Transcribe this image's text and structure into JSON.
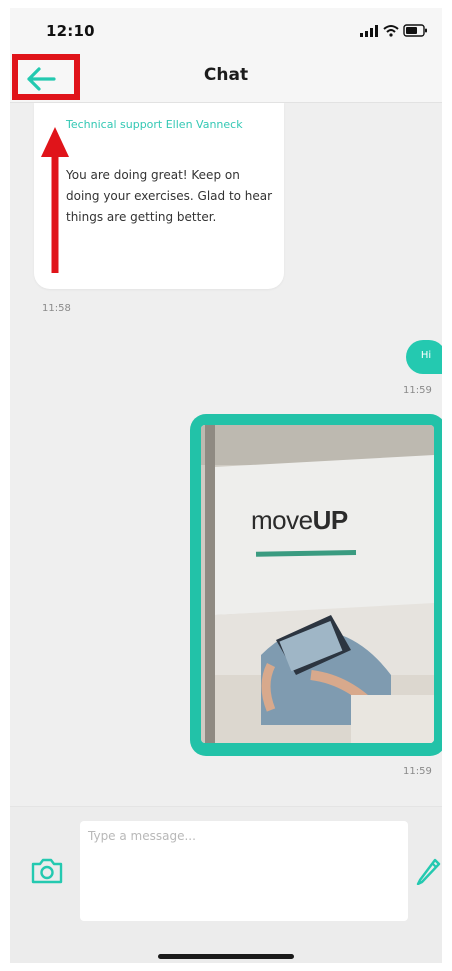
{
  "status_bar": {
    "time": "12:10"
  },
  "header": {
    "title": "Chat",
    "back_icon": "arrow-left-icon"
  },
  "messages": [
    {
      "direction": "incoming",
      "sender": "Technical support Ellen Vanneck",
      "text": "You are doing great! Keep on doing your exercises. Glad to hear things are getting better.",
      "time": "11:58"
    },
    {
      "direction": "outgoing",
      "text": "Hi",
      "time": "11:59"
    },
    {
      "direction": "outgoing",
      "type": "photo",
      "photo_text": "moveUP",
      "time": "11:59"
    }
  ],
  "composer": {
    "placeholder": "Type a message...",
    "camera_icon": "camera-icon",
    "edit_icon": "pencil-icon"
  },
  "annotation": {
    "color": "#e0141a"
  },
  "colors": {
    "accent": "#24c9b0"
  }
}
